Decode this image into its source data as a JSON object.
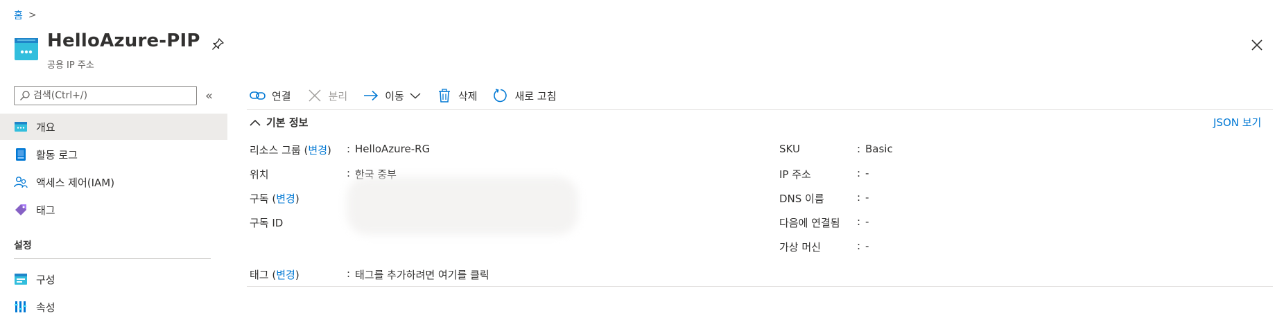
{
  "breadcrumb": {
    "home": "홈",
    "separator": ">"
  },
  "header": {
    "title": "HelloAzure-PIP",
    "subtitle": "공용 IP 주소",
    "pin_icon": "pin-icon",
    "close_icon": "close-icon"
  },
  "sidebar": {
    "search_placeholder": "검색(Ctrl+/)",
    "collapse_label": "«",
    "items": [
      {
        "label": "개요",
        "icon": "overview-icon",
        "active": true
      },
      {
        "label": "활동 로그",
        "icon": "activity-log-icon"
      },
      {
        "label": "액세스 제어(IAM)",
        "icon": "iam-icon"
      },
      {
        "label": "태그",
        "icon": "tag-icon"
      }
    ],
    "section_title": "설정",
    "settings_items": [
      {
        "label": "구성",
        "icon": "configuration-icon"
      },
      {
        "label": "속성",
        "icon": "properties-icon"
      }
    ]
  },
  "toolbar": {
    "associate": "연결",
    "dissociate": "분리",
    "move": "이동",
    "delete": "삭제",
    "refresh": "새로 고침"
  },
  "essentials": {
    "header": "기본 정보",
    "json_view": "JSON 보기",
    "left": {
      "resource_group_label": "리소스 그룹",
      "change_label": "변경",
      "resource_group_value": "HelloAzure-RG",
      "location_label": "위치",
      "location_value": "한국 중부",
      "subscription_label": "구독",
      "subscription_change": "변경",
      "subscription_id_label": "구독 ID"
    },
    "right": {
      "sku_label": "SKU",
      "sku_value": "Basic",
      "ip_label": "IP 주소",
      "ip_value": "-",
      "dns_label": "DNS 이름",
      "dns_value": "-",
      "associated_label": "다음에 연결됨",
      "associated_value": "-",
      "vm_label": "가상 머신",
      "vm_value": "-"
    },
    "tags_label": "태그",
    "tags_change": "변경",
    "tags_value": "태그를 추가하려면 여기를 클릭"
  },
  "colors": {
    "accent": "#0078d4",
    "active_bg": "#edebe9",
    "text": "#323130"
  }
}
